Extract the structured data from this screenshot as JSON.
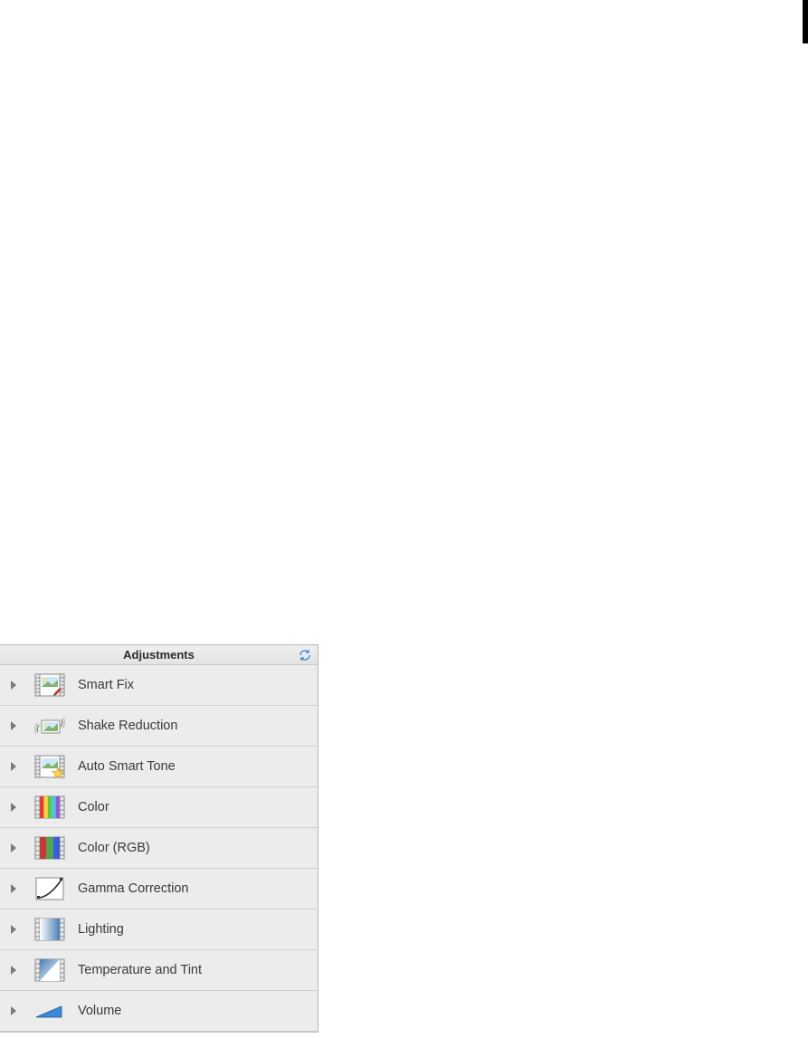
{
  "panel": {
    "title": "Adjustments",
    "items": [
      {
        "label": "Smart Fix",
        "icon": "smart-fix"
      },
      {
        "label": "Shake Reduction",
        "icon": "shake-reduction"
      },
      {
        "label": "Auto Smart Tone",
        "icon": "auto-smart-tone"
      },
      {
        "label": "Color",
        "icon": "color"
      },
      {
        "label": "Color (RGB)",
        "icon": "color-rgb"
      },
      {
        "label": "Gamma Correction",
        "icon": "gamma-correction"
      },
      {
        "label": "Lighting",
        "icon": "lighting"
      },
      {
        "label": "Temperature and Tint",
        "icon": "temperature-tint"
      },
      {
        "label": "Volume",
        "icon": "volume"
      }
    ]
  }
}
